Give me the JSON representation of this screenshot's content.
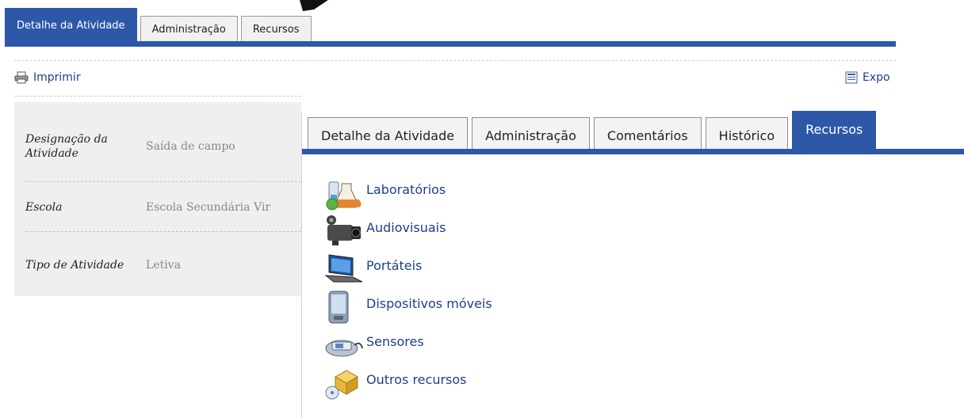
{
  "background": {
    "tabs": [
      "Detalhe da Atividade",
      "Administração",
      "Recursos"
    ],
    "print_label": "Imprimir",
    "export_label": "Expo",
    "details": [
      {
        "label": "Designação da Atividade",
        "value": "Saída de campo"
      },
      {
        "label": "Escola",
        "value": "Escola Secundária Vir"
      },
      {
        "label": "Tipo de Atividade",
        "value": "Letiva"
      }
    ]
  },
  "panel": {
    "tabs": [
      "Detalhe da Atividade",
      "Administração",
      "Comentários",
      "Histórico",
      "Recursos"
    ],
    "active_tab": "Recursos",
    "resources": [
      {
        "label": "Laboratórios",
        "icon": "laboratory-icon"
      },
      {
        "label": "Audiovisuais",
        "icon": "camcorder-icon"
      },
      {
        "label": "Portáteis",
        "icon": "laptop-icon"
      },
      {
        "label": "Dispositivos móveis",
        "icon": "mobile-device-icon"
      },
      {
        "label": "Sensores",
        "icon": "sensor-icon"
      },
      {
        "label": "Outros recursos",
        "icon": "other-resources-icon"
      }
    ]
  },
  "colors": {
    "accent": "#2d58a8",
    "link": "#1f3f86",
    "details_bg": "#efefef"
  }
}
